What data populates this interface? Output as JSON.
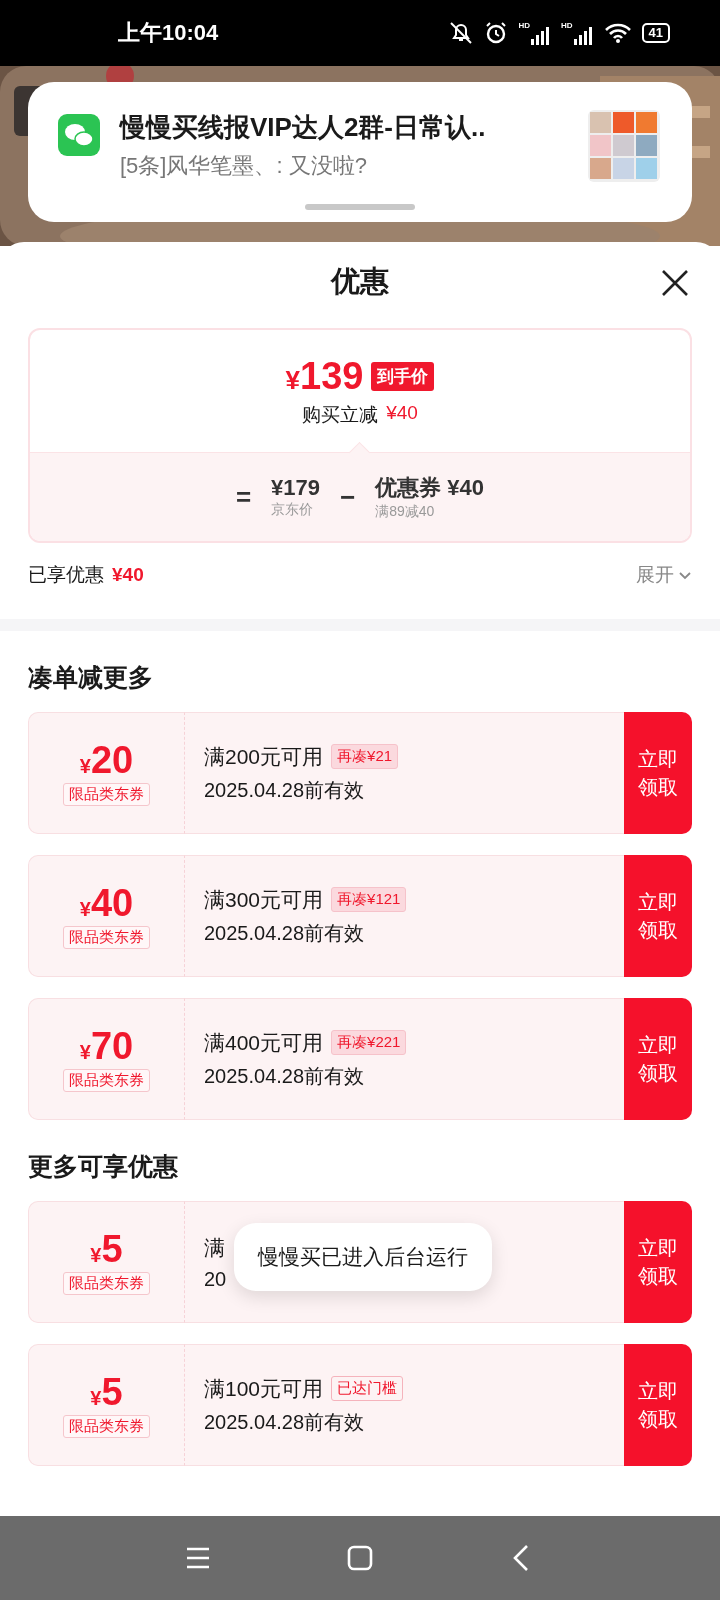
{
  "status_bar": {
    "time": "上午10:04",
    "signal_labels": [
      "HD",
      "HD"
    ],
    "battery": "41"
  },
  "notification": {
    "title": "慢慢买线报VIP达人2群-日常认..",
    "message": "[5条]风华笔墨、: 又没啦?"
  },
  "sheet": {
    "title": "优惠",
    "price_card": {
      "currency": "¥",
      "price": "139",
      "badge": "到手价",
      "reduction_label": "购买立减",
      "reduction": "¥40",
      "equals": "=",
      "original_price": "¥179",
      "original_label": "京东价",
      "minus": "−",
      "coupon_label": "优惠券 ¥40",
      "coupon_rule": "满89减40"
    },
    "enjoyed": {
      "label": "已享优惠",
      "amount": "¥40",
      "expand": "展开"
    },
    "sections": [
      {
        "title": "凑单减更多",
        "coupons": [
          {
            "currency": "¥",
            "amount": "20",
            "scope": "限品类东券",
            "condition": "满200元可用",
            "tag": {
              "kind": "gap",
              "text": "再凑¥21"
            },
            "validity": "2025.04.28前有效",
            "button": "立即领取"
          },
          {
            "currency": "¥",
            "amount": "40",
            "scope": "限品类东券",
            "condition": "满300元可用",
            "tag": {
              "kind": "gap",
              "text": "再凑¥121"
            },
            "validity": "2025.04.28前有效",
            "button": "立即领取"
          },
          {
            "currency": "¥",
            "amount": "70",
            "scope": "限品类东券",
            "condition": "满400元可用",
            "tag": {
              "kind": "gap",
              "text": "再凑¥221"
            },
            "validity": "2025.04.28前有效",
            "button": "立即领取"
          }
        ]
      },
      {
        "title": "更多可享优惠",
        "coupons": [
          {
            "currency": "¥",
            "amount": "5",
            "scope": "限品类东券",
            "condition": "满",
            "validity": "20",
            "button": "立即领取",
            "toast": "慢慢买已进入后台运行"
          },
          {
            "currency": "¥",
            "amount": "5",
            "scope": "限品类东券",
            "condition": "满100元可用",
            "tag": {
              "kind": "reached",
              "text": "已达门槛"
            },
            "validity": "2025.04.28前有效",
            "button": "立即领取"
          }
        ]
      }
    ]
  }
}
